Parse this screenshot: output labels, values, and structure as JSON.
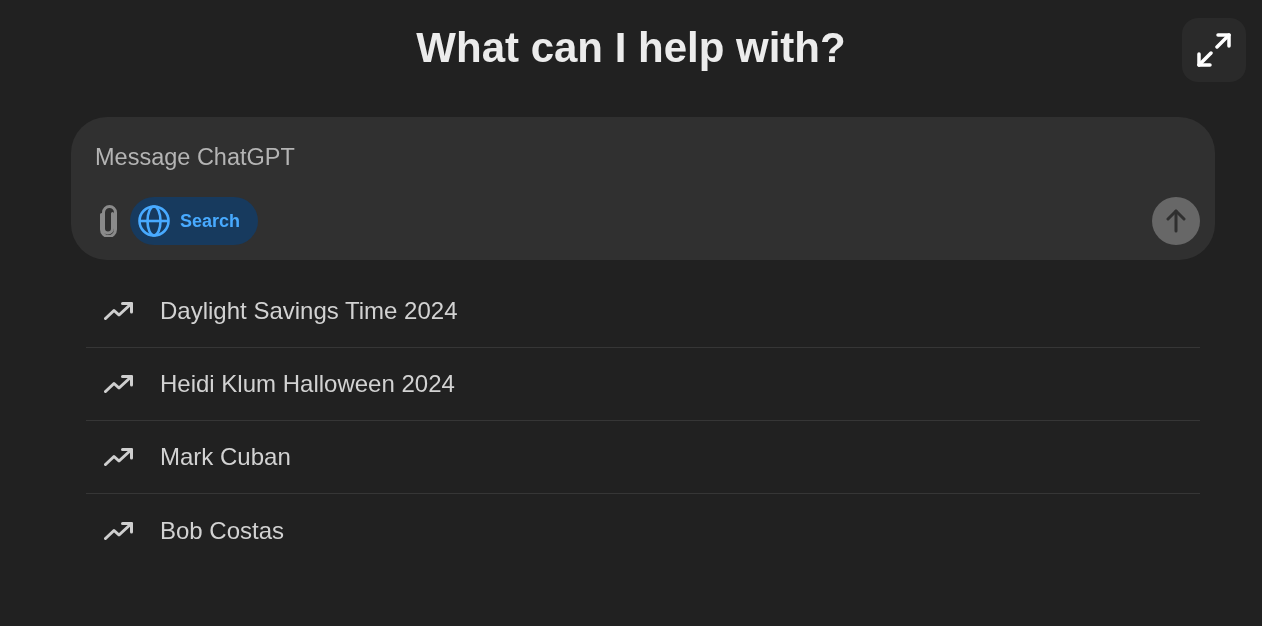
{
  "header": {
    "title": "What can I help with?"
  },
  "composer": {
    "placeholder": "Message ChatGPT",
    "search_button": {
      "label": "Search",
      "selected": true
    },
    "send_button": {
      "disabled": true
    }
  },
  "suggestions": [
    "Daylight Savings Time 2024",
    "Heidi Klum Halloween 2024",
    "Mark Cuban",
    "Bob Costas"
  ]
}
